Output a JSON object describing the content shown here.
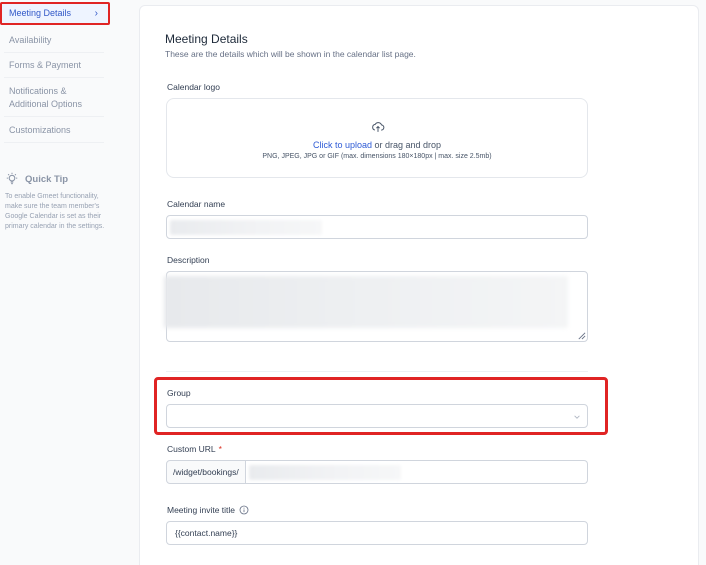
{
  "sidebar": {
    "items": [
      {
        "label": "Meeting Details",
        "active": true,
        "chevron": "›"
      },
      {
        "label": "Availability"
      },
      {
        "label": "Forms & Payment"
      },
      {
        "label": "Notifications & Additional Options"
      },
      {
        "label": "Customizations"
      }
    ],
    "quick_tip": {
      "title": "Quick Tip",
      "icon": "lightbulb-icon",
      "text": "To enable Gmeet functionality, make sure the team member's Google Calendar is set as their primary calendar in the settings."
    }
  },
  "main": {
    "title": "Meeting Details",
    "subtitle": "These are the details which will be shown in the calendar list page.",
    "calendar_logo": {
      "label": "Calendar logo",
      "upload_link": "Click to upload",
      "upload_rest": " or drag and drop",
      "hint": "PNG, JPEG, JPG or GIF (max. dimensions 180×180px | max. size 2.5mb)"
    },
    "calendar_name": {
      "label": "Calendar name"
    },
    "description": {
      "label": "Description"
    },
    "group": {
      "label": "Group",
      "value": ""
    },
    "custom_url": {
      "label": "Custom URL",
      "required_mark": "*",
      "prefix": "/widget/bookings/"
    },
    "invite_title": {
      "label": "Meeting invite title",
      "value": "{{contact.name}}"
    }
  },
  "colors": {
    "accent": "#2e5bd6",
    "highlight": "#e02424",
    "active_bg": "#eef4ff"
  }
}
